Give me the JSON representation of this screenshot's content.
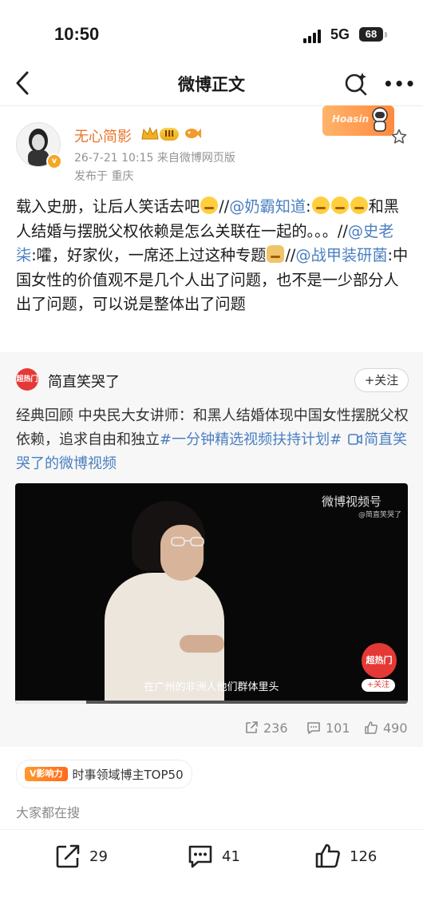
{
  "status_bar": {
    "time": "10:50",
    "network": "5G",
    "battery": "68"
  },
  "nav": {
    "title": "微博正文"
  },
  "author": {
    "name": "无心简影",
    "level": "III",
    "time_source": "26-7-21 10:15  来自微博网页版",
    "location": "发布于 重庆",
    "decor_text": "Hoasin"
  },
  "post": {
    "t1": "载入史册，让后人笑话去吧",
    "t2": "//",
    "m1": "@奶霸知道",
    "t3": ":",
    "t4": "和黑人结婚与摆脱父权依赖是怎么关联在一起的。。。//",
    "m2": "@史老柒",
    "t5": ":嚯，好家伙，一席还上过这种专题",
    "t6": "//",
    "m3": "@战甲装研菌",
    "t7": ":中国女性的价值观不是几个人出了问题，也不是一少部分人出了问题，可以说是整体出了问题"
  },
  "repost": {
    "avatar_text": "超热门",
    "name": "简直笑哭了",
    "follow": "+关注",
    "text": "经典回顾 中央民大女讲师：和黑人结婚体现中国女性摆脱父权依赖，追求自由和独立",
    "topic": "#一分钟精选视频扶持计划#",
    "video_link": "简直笑哭了的微博视频",
    "video": {
      "watermark": "微博视频号",
      "watermark_sub": "@简直笑哭了",
      "subtitle": "在广州的非洲人他们群体里头",
      "hot_label": "超热门",
      "follow": "+关注",
      "progress": 0.18
    },
    "stats": {
      "reposts": "236",
      "comments": "101",
      "likes": "490"
    }
  },
  "influence": {
    "badge": "V影响力",
    "text": "时事领域博主TOP50"
  },
  "search_section": {
    "title": "大家都在搜"
  },
  "bottom_bar": {
    "reposts": "29",
    "comments": "41",
    "likes": "126"
  }
}
